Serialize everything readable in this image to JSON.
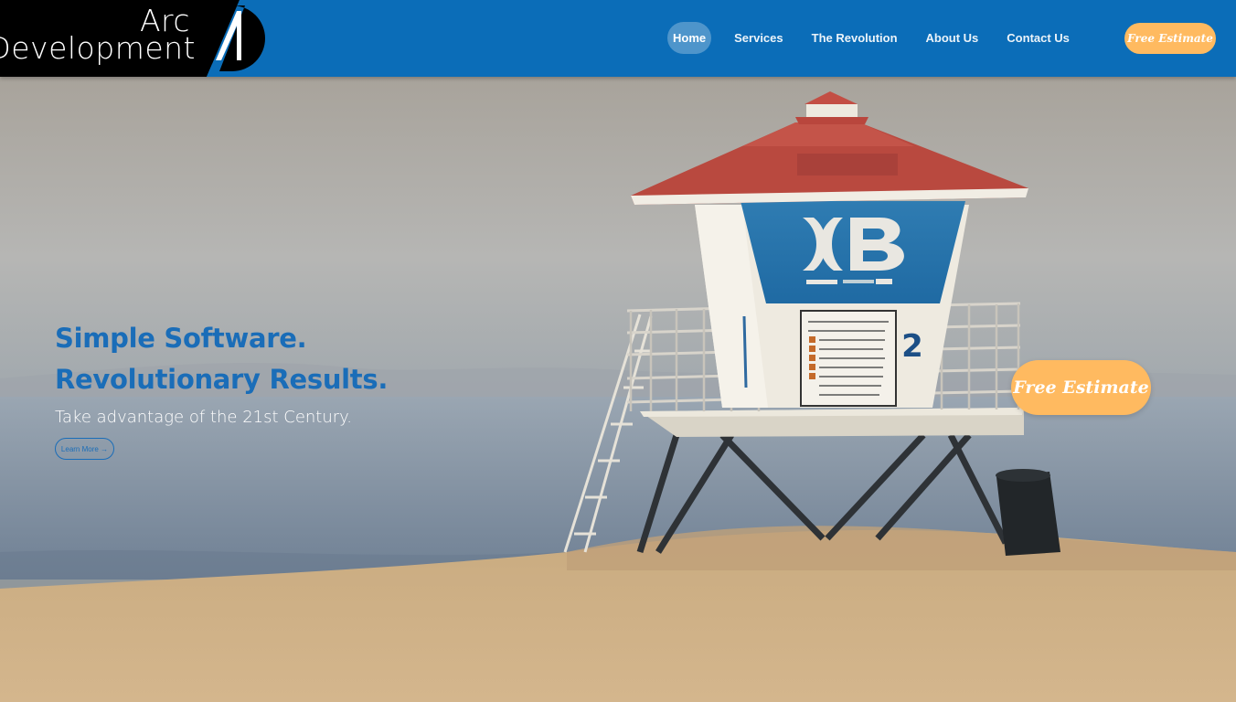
{
  "brand": {
    "line1": "Arc",
    "line2": "Development"
  },
  "nav": {
    "tabs": [
      {
        "label": "Home",
        "active": true
      },
      {
        "label": "Services",
        "active": false
      },
      {
        "label": "The Revolution",
        "active": false
      },
      {
        "label": "About Us",
        "active": false
      },
      {
        "label": "Contact Us",
        "active": false
      }
    ],
    "estimate_label": "Free Estimate"
  },
  "hero": {
    "title_line1": "Simple Software.",
    "title_line2": "Revolutionary Results.",
    "subtitle": "Take advantage of the 21st Century.",
    "learn_more_label": "Learn More",
    "learn_more_icon": "arrow-right-icon",
    "estimate_label": "Free Estimate",
    "tower_number": "2"
  },
  "colors": {
    "header_blue": "#0b6db8",
    "accent_orange": "#ffba60",
    "text_blue": "#1a6db8"
  }
}
